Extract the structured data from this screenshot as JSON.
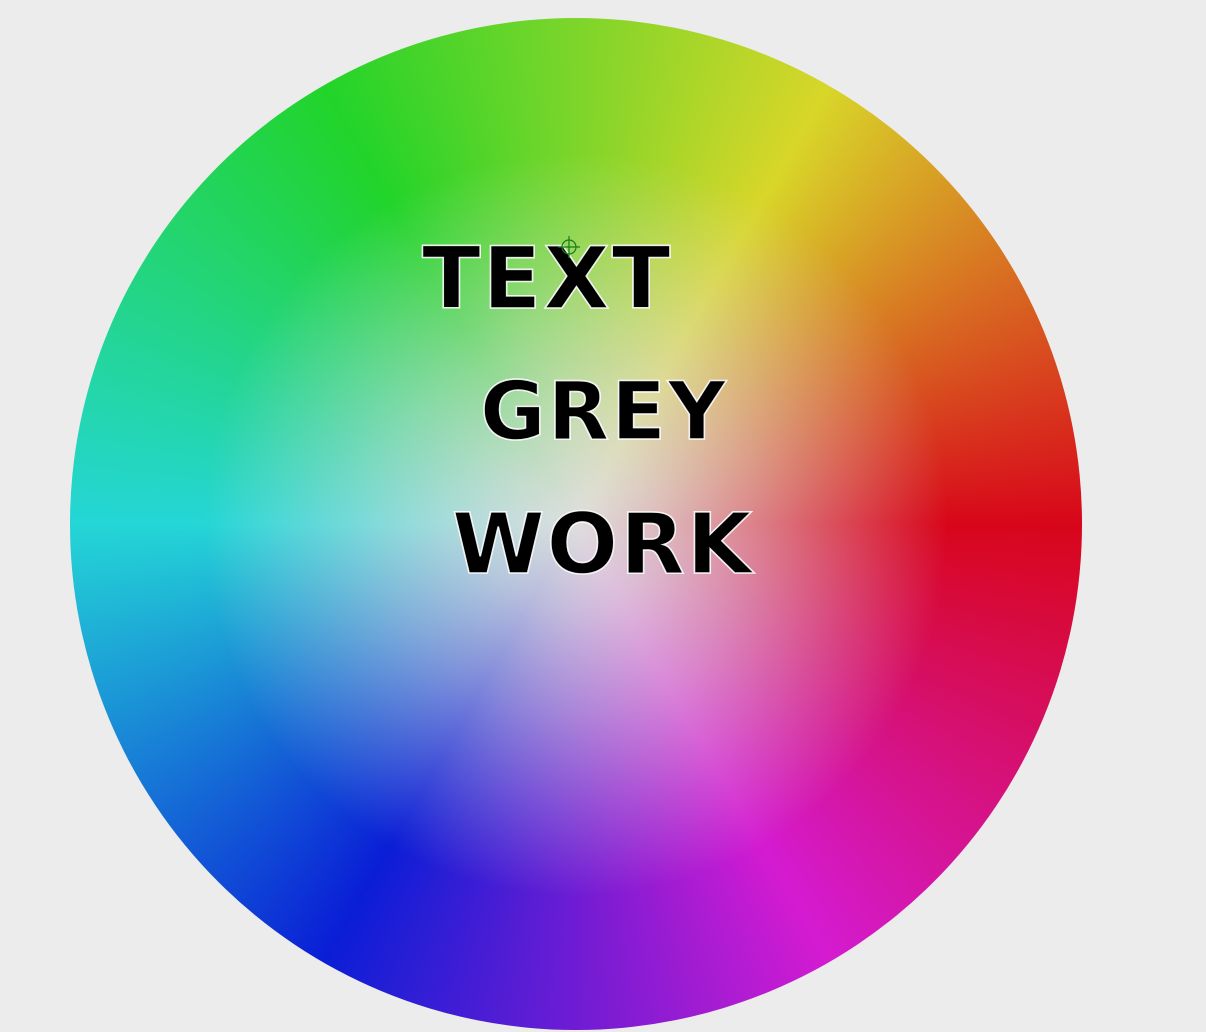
{
  "words": {
    "line1": "TEXT",
    "line2": "GREY",
    "line3": "WORK"
  },
  "colors": {
    "background": "#ececec",
    "text": "#000000",
    "wheel_red": "#d8061a",
    "wheel_magenta": "#d41bd1",
    "wheel_blue": "#0a1ed6",
    "wheel_cyan": "#24d6d6",
    "wheel_green": "#22d42a",
    "wheel_yellow": "#d8d629",
    "wheel_center": "#dedede"
  },
  "cursor": {
    "icon": "crosshair-cursor-icon"
  }
}
